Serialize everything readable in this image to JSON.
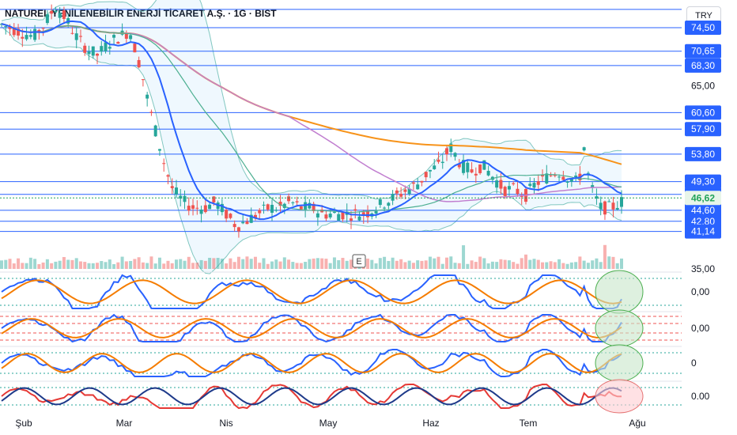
{
  "header": {
    "title": "NATUREL YENİLENEBİLİR ENERJİ TİCARET A.Ş. · 1G · BIST",
    "currency": "TRY"
  },
  "colors": {
    "up": "#26a69a",
    "down": "#ef5350",
    "level_line": "#2962ff",
    "ma_fast": "#2962ff",
    "ma_mid": "#4caf91",
    "ma_slow": "#c17fd0",
    "ma_long": "#f7931a",
    "label_bg": "#2962ff",
    "current_bg": "#e8f5e9",
    "current_text": "#22a35a"
  },
  "event_marker": "E",
  "chart_data": {
    "type": "candlestick",
    "x_tick_labels": [
      "Şub",
      "Mar",
      "Nis",
      "May",
      "Haz",
      "Tem",
      "Ağu"
    ],
    "price_scale_labels": [
      "65,00",
      "35,00"
    ],
    "level_labels": [
      "74,50",
      "70,65",
      "68,30",
      "60,60",
      "57,90",
      "53,80",
      "49,30",
      "47,20",
      "44,60",
      "42,80",
      "41,14"
    ],
    "current_price": "46,62",
    "ylim": [
      35,
      78
    ],
    "horizontal_levels": [
      77.5,
      74.5,
      70.65,
      68.3,
      60.6,
      57.9,
      53.8,
      49.3,
      47.2,
      44.6,
      42.8,
      41.14
    ],
    "close_path": [
      [
        0,
        75
      ],
      [
        6,
        74
      ],
      [
        12,
        73
      ],
      [
        16,
        75
      ],
      [
        20,
        78
      ],
      [
        24,
        76
      ],
      [
        28,
        73
      ],
      [
        32,
        71
      ],
      [
        36,
        70
      ],
      [
        40,
        72
      ],
      [
        44,
        73
      ],
      [
        48,
        74
      ],
      [
        52,
        68
      ],
      [
        55,
        62
      ],
      [
        58,
        57
      ],
      [
        61,
        52
      ],
      [
        64,
        48
      ],
      [
        68,
        46
      ],
      [
        72,
        45
      ],
      [
        76,
        45
      ],
      [
        80,
        46
      ],
      [
        84,
        44
      ],
      [
        88,
        42
      ],
      [
        92,
        43
      ],
      [
        96,
        44
      ],
      [
        100,
        45
      ],
      [
        104,
        45
      ],
      [
        108,
        46
      ],
      [
        112,
        45
      ],
      [
        116,
        45
      ],
      [
        120,
        44
      ],
      [
        124,
        44
      ],
      [
        128,
        44
      ],
      [
        132,
        44
      ],
      [
        136,
        44
      ],
      [
        140,
        45
      ],
      [
        144,
        46
      ],
      [
        148,
        47
      ],
      [
        152,
        48
      ],
      [
        156,
        49
      ],
      [
        160,
        51
      ],
      [
        164,
        52
      ],
      [
        168,
        55
      ],
      [
        172,
        52
      ],
      [
        176,
        51
      ],
      [
        180,
        52
      ],
      [
        184,
        50
      ],
      [
        188,
        48
      ],
      [
        192,
        48
      ],
      [
        196,
        47
      ],
      [
        200,
        49
      ],
      [
        204,
        50
      ],
      [
        208,
        51
      ],
      [
        212,
        50
      ],
      [
        216,
        49
      ],
      [
        218,
        55
      ],
      [
        220,
        49
      ],
      [
        222,
        47
      ],
      [
        224,
        45
      ],
      [
        226,
        45
      ],
      [
        228,
        45
      ],
      [
        232,
        46
      ]
    ],
    "panel_values": [
      "0,00",
      "0,00",
      "0",
      "0.00"
    ]
  }
}
